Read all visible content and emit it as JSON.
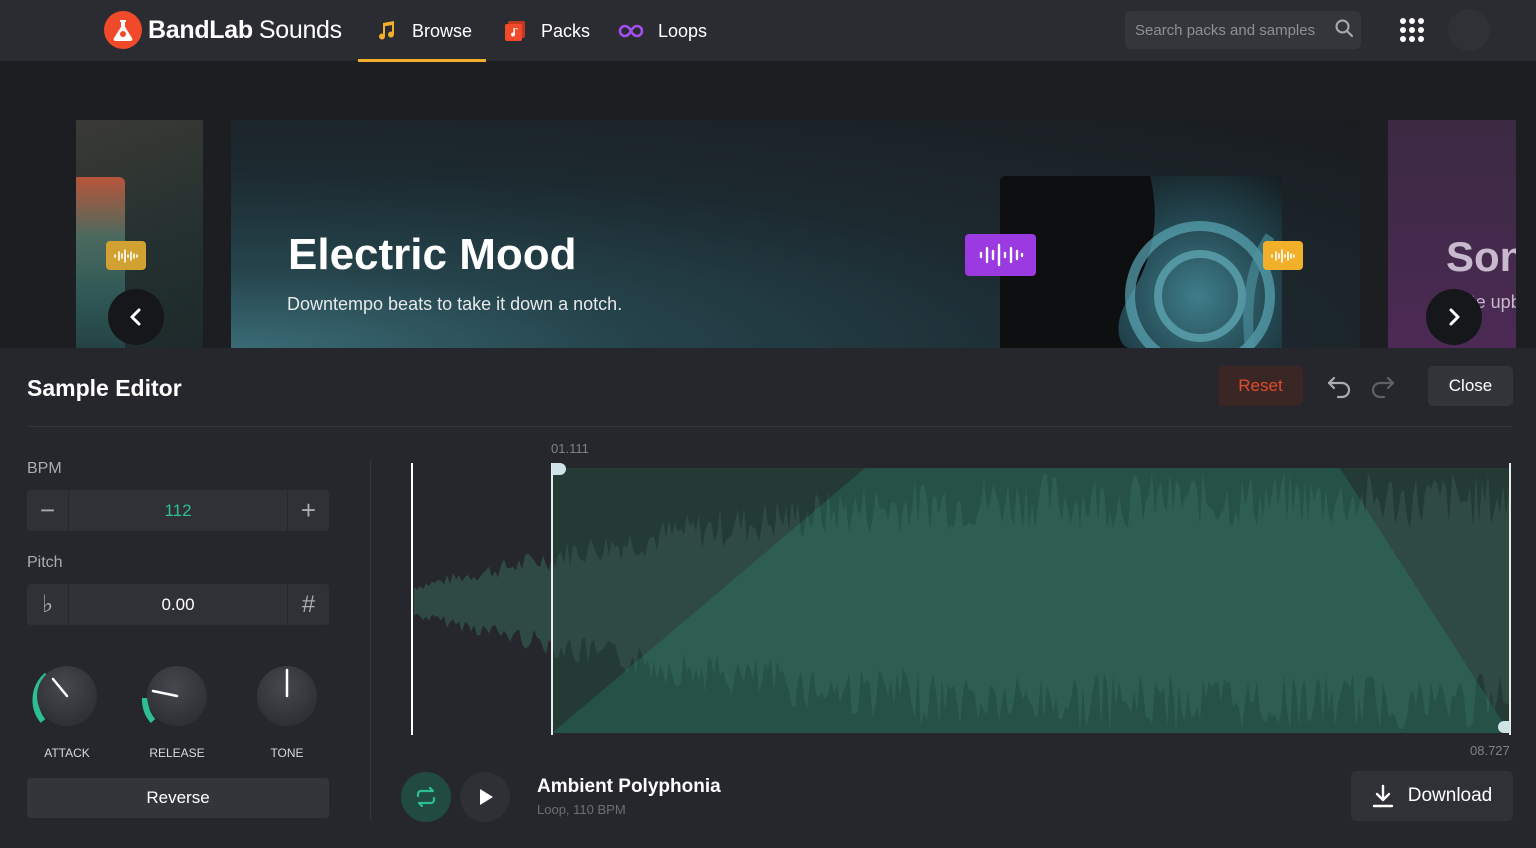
{
  "brand": {
    "name_bold": "BandLab",
    "name_light": "Sounds",
    "accent": "#f04a2b"
  },
  "nav": {
    "tabs": [
      {
        "label": "Browse",
        "icon": "music-note-icon",
        "color": "#f2b02a",
        "active": true
      },
      {
        "label": "Packs",
        "icon": "packs-icon",
        "color": "#f04a2b",
        "active": false
      },
      {
        "label": "Loops",
        "icon": "infinity-icon",
        "color": "#a34ff0",
        "active": false
      }
    ],
    "search_placeholder": "Search packs and samples"
  },
  "carousel": {
    "current": {
      "title": "Electric Mood",
      "subtitle": "Downtempo beats to take it down a notch."
    },
    "next_partial": {
      "title": "Son",
      "subtitle": "Write upb"
    }
  },
  "editor": {
    "title": "Sample Editor",
    "reset_label": "Reset",
    "close_label": "Close",
    "bpm": {
      "label": "BPM",
      "value": "112",
      "minus": "−",
      "plus": "+"
    },
    "pitch": {
      "label": "Pitch",
      "value": "0.00",
      "flat": "♭",
      "sharp": "#"
    },
    "knobs": [
      {
        "label": "ATTACK"
      },
      {
        "label": "RELEASE"
      },
      {
        "label": "TONE"
      }
    ],
    "reverse_label": "Reverse",
    "waveform": {
      "start_time": "01.111",
      "end_time": "08.727",
      "color": "#2ebe96"
    },
    "track": {
      "title": "Ambient Polyphonia",
      "subtitle": "Loop, 110 BPM"
    },
    "download_label": "Download"
  }
}
